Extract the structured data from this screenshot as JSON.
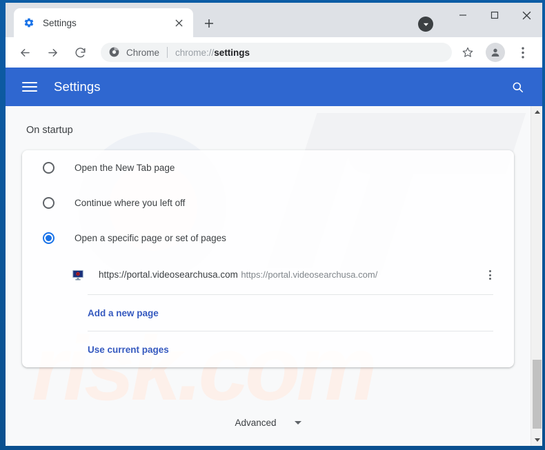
{
  "window": {
    "controls": {
      "minimize_label": "–",
      "maximize_label": "□",
      "close_label": "✕"
    }
  },
  "tab_strip": {
    "tab": {
      "favicon": "gear-icon",
      "title": "Settings",
      "close_label": "✕"
    },
    "new_tab_label": "+"
  },
  "toolbar": {
    "back_icon": "back-arrow-icon",
    "forward_icon": "forward-arrow-icon",
    "reload_icon": "reload-icon",
    "omnibox": {
      "site_icon": "chrome-logo-icon",
      "scheme_label": "Chrome",
      "url_prefix": "chrome://",
      "url_page": "settings",
      "full_url": "chrome://settings"
    },
    "star_icon": "bookmark-star-icon",
    "avatar_icon": "profile-avatar-icon",
    "menu_icon": "three-dot-menu-icon"
  },
  "settings_header": {
    "menu_icon": "hamburger-menu-icon",
    "title": "Settings",
    "search_icon": "search-icon"
  },
  "settings": {
    "section_title": "On startup",
    "startup_options": [
      {
        "label": "Open the New Tab page",
        "selected": false
      },
      {
        "label": "Continue where you left off",
        "selected": false
      },
      {
        "label": "Open a specific page or set of pages",
        "selected": true
      }
    ],
    "startup_page": {
      "favicon": "monitor-site-icon",
      "title": "https://portal.videosearchusa.com",
      "url": "https://portal.videosearchusa.com/",
      "menu_icon": "three-dot-menu-icon"
    },
    "add_page_link": "Add a new page",
    "use_current_pages_link": "Use current pages",
    "advanced_label": "Advanced",
    "advanced_caret_icon": "chevron-down-icon"
  },
  "colors": {
    "header_blue": "#2f67d0",
    "accent_blue": "#1a73e8",
    "link_blue": "#3559bf",
    "window_border": "#0b5ba3",
    "tabstrip_gray": "#dee1e6",
    "page_bg": "#f8f9fa"
  },
  "watermark": {
    "text": "risk.com"
  },
  "scrollbar": {
    "up_arrow_icon": "scroll-up-arrow-icon",
    "down_arrow_icon": "scroll-down-arrow-icon"
  }
}
